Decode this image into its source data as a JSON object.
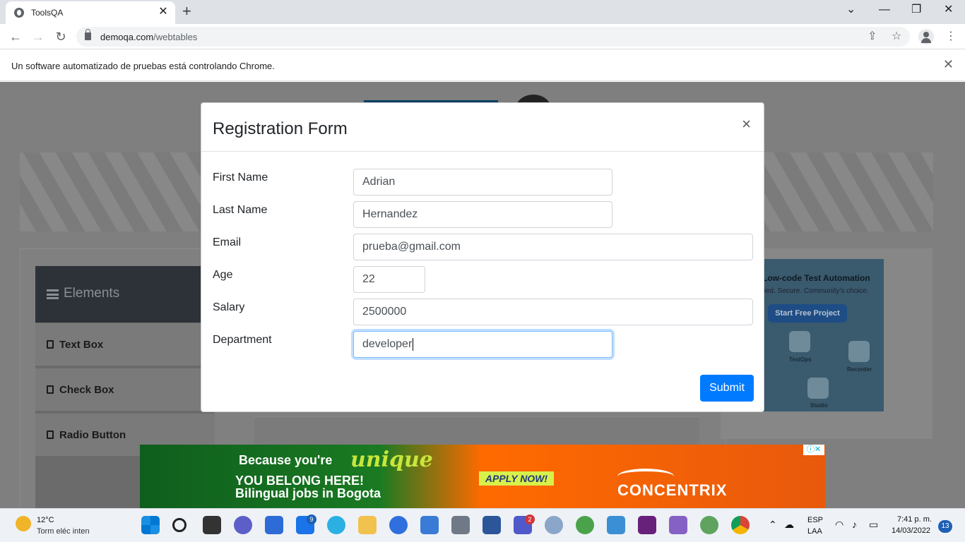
{
  "browser": {
    "tab_title": "ToolsQA",
    "url_host": "demoqa.com",
    "url_path": "/webtables",
    "infobar_message": "Un software automatizado de pruebas está controlando Chrome."
  },
  "sidebar": {
    "header": "Elements",
    "items": [
      {
        "label": "Text Box"
      },
      {
        "label": "Check Box"
      },
      {
        "label": "Radio Button"
      }
    ]
  },
  "side_ad": {
    "headline": "Low-code Test Automation",
    "subline": "fied. Secure. Community's choice.",
    "button": "Start Free Project",
    "chip_labels": [
      "TestOps",
      "Recorder",
      "Studio"
    ]
  },
  "modal": {
    "title": "Registration Form",
    "close_glyph": "×",
    "fields": [
      {
        "label": "First Name",
        "value": "Adrian"
      },
      {
        "label": "Last Name",
        "value": "Hernandez"
      },
      {
        "label": "Email",
        "value": "prueba@gmail.com"
      },
      {
        "label": "Age",
        "value": "22"
      },
      {
        "label": "Salary",
        "value": "2500000"
      },
      {
        "label": "Department",
        "value": "developer"
      }
    ],
    "submit_label": "Submit"
  },
  "bottom_ad": {
    "line1": "Because you're",
    "accent_word": "unique",
    "line2": "YOU BELONG HERE!",
    "line3": "Bilingual jobs in Bogota",
    "cta": "APPLY NOW!",
    "brand": "CONCENTRIX"
  },
  "taskbar": {
    "weather_temp": "12°C",
    "weather_desc": "Torm eléc inten",
    "mail_badge": "9",
    "teams_badge": "2",
    "lang_line1": "ESP",
    "lang_line2": "LAA",
    "time": "7:41 p. m.",
    "date": "14/03/2022",
    "notifications": "13"
  },
  "colors": {
    "primary": "#007bff",
    "overlay": "#7f7f7f",
    "sidebar_header": "#2d3238"
  }
}
